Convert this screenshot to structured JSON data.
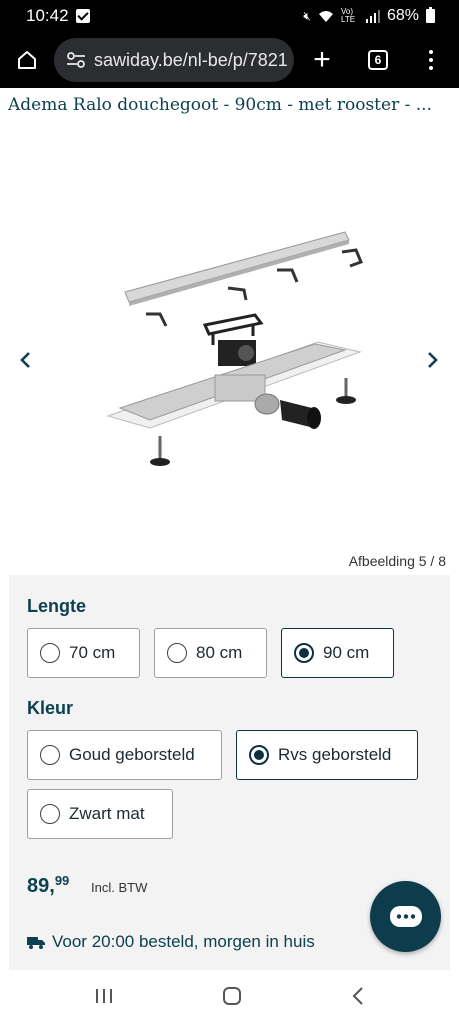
{
  "status": {
    "time": "10:42",
    "battery": "68%",
    "lte": "Vo) LTE"
  },
  "browser": {
    "url": "sawiday.be/nl-be/p/7821",
    "tab_count": "6"
  },
  "product": {
    "title": "Adema Ralo douchegoot - 90cm - met rooster - ..."
  },
  "gallery": {
    "counter": "Afbeelding 5 / 8"
  },
  "length": {
    "heading": "Lengte",
    "options": [
      {
        "label": "70 cm",
        "selected": false
      },
      {
        "label": "80 cm",
        "selected": false
      },
      {
        "label": "90 cm",
        "selected": true
      }
    ]
  },
  "color": {
    "heading": "Kleur",
    "options": [
      {
        "label": "Goud geborsteld",
        "selected": false
      },
      {
        "label": "Rvs geborsteld",
        "selected": true
      },
      {
        "label": "Zwart mat",
        "selected": false
      }
    ]
  },
  "price": {
    "whole": "89,",
    "cents": "99",
    "vat_note": "Incl. BTW"
  },
  "delivery": {
    "text": "Voor 20:00 besteld, morgen in huis",
    "icon": "truck-icon"
  },
  "colors": {
    "brand": "#0d3d4c",
    "panel": "#f3f3f3"
  }
}
